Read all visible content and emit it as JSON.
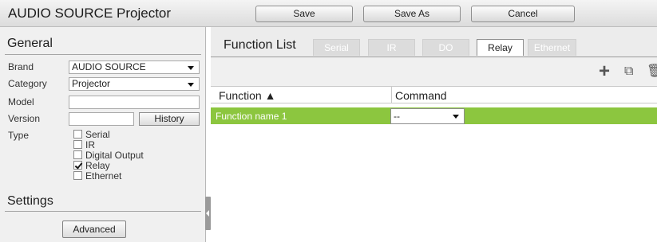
{
  "window": {
    "title": "AUDIO SOURCE Projector"
  },
  "toolbar": {
    "save": "Save",
    "save_as": "Save As",
    "cancel": "Cancel"
  },
  "general": {
    "heading": "General",
    "brand_label": "Brand",
    "brand_value": "AUDIO SOURCE",
    "category_label": "Category",
    "category_value": "Projector",
    "model_label": "Model",
    "model_value": "",
    "version_label": "Version",
    "version_value": "",
    "history_button": "History",
    "type_label": "Type",
    "types": [
      {
        "label": "Serial",
        "checked": false
      },
      {
        "label": "IR",
        "checked": false
      },
      {
        "label": "Digital Output",
        "checked": false
      },
      {
        "label": "Relay",
        "checked": true
      },
      {
        "label": "Ethernet",
        "checked": false
      }
    ]
  },
  "settings": {
    "heading": "Settings",
    "advanced_button": "Advanced"
  },
  "function_list": {
    "heading": "Function List",
    "tabs": [
      {
        "label": "Serial",
        "active": false
      },
      {
        "label": "IR",
        "active": false
      },
      {
        "label": "DO",
        "active": false
      },
      {
        "label": "Relay",
        "active": true
      },
      {
        "label": "Ethernet",
        "active": false
      }
    ],
    "tools": [
      {
        "icon": "plus-icon",
        "glyph": "+"
      },
      {
        "icon": "copy-icon",
        "glyph": "⧉"
      },
      {
        "icon": "trash-icon",
        "glyph": "🗑"
      }
    ],
    "columns": {
      "function": "Function ▲",
      "command": "Command"
    },
    "rows": [
      {
        "function": "Function name 1",
        "command": "--"
      }
    ],
    "selected_row_color": "#8cc63f"
  }
}
